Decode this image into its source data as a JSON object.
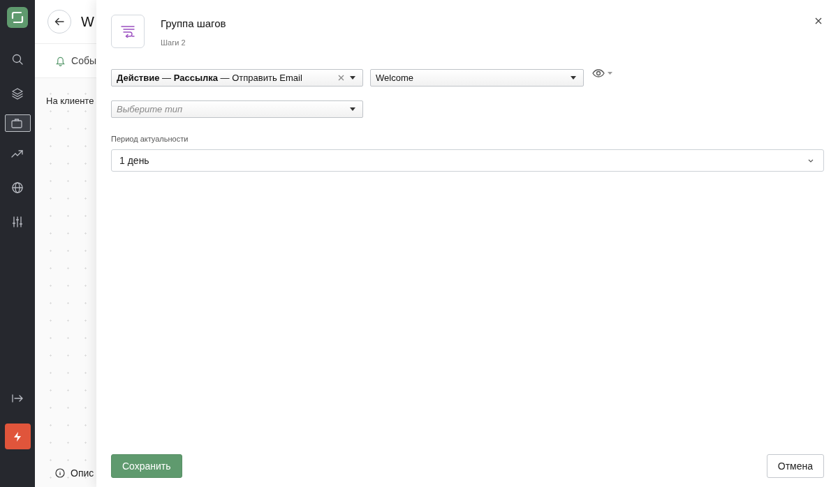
{
  "sidebar": {
    "items": [
      {
        "kind": "search",
        "selected": false
      },
      {
        "kind": "layers",
        "selected": false
      },
      {
        "kind": "briefcase",
        "selected": true
      },
      {
        "kind": "trend",
        "selected": false
      },
      {
        "kind": "globe",
        "selected": false
      },
      {
        "kind": "sliders",
        "selected": false
      }
    ],
    "bottom": [
      {
        "kind": "collapse"
      },
      {
        "kind": "bolt"
      }
    ]
  },
  "page": {
    "title": "W",
    "tab": "Собы",
    "section": "На клиенте",
    "footer": "Опис"
  },
  "drawer": {
    "title": "Группа шагов",
    "subtitle": "Шаги 2",
    "action_select": {
      "value": "**Действие** — **Рассылка** — Отправить Email",
      "clearable": true
    },
    "template_select": {
      "value": "Welcome"
    },
    "type_select": {
      "placeholder": "Выберите тип"
    },
    "period": {
      "label": "Период актуальности",
      "value": "1 день"
    },
    "buttons": [
      {
        "label": "Сохранить",
        "kind": "primary"
      },
      {
        "label": "Отмена",
        "kind": "secondary"
      }
    ]
  }
}
